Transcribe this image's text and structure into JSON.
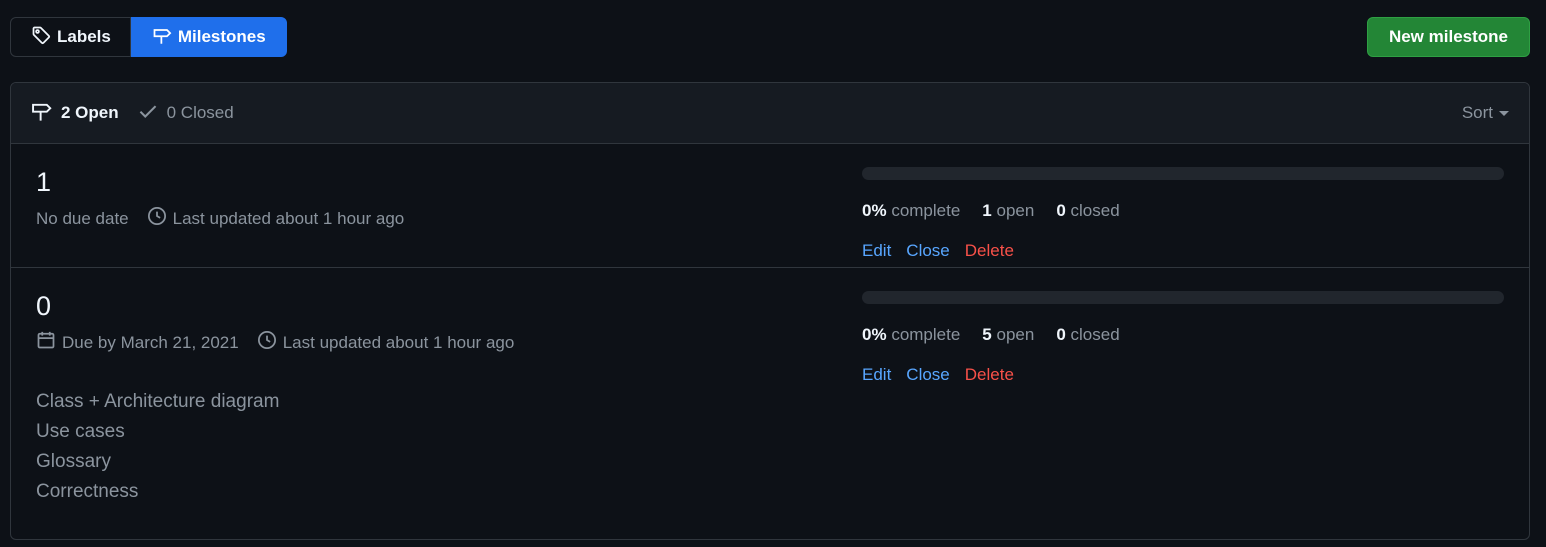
{
  "toolbar": {
    "labels_tab": "Labels",
    "milestones_tab": "Milestones",
    "new_milestone": "New milestone"
  },
  "header": {
    "open_label": "2 Open",
    "closed_label": "0 Closed",
    "sort_label": "Sort"
  },
  "milestones": [
    {
      "title": "1",
      "due": "No due date",
      "updated": "Last updated about 1 hour ago",
      "description": [],
      "progress_percent": 0,
      "complete_value": "0%",
      "complete_label": "complete",
      "open_count": "1",
      "open_label": "open",
      "closed_count": "0",
      "closed_label": "closed",
      "edit": "Edit",
      "close": "Close",
      "delete": "Delete"
    },
    {
      "title": "0",
      "due": "Due by March 21, 2021",
      "updated": "Last updated about 1 hour ago",
      "description": [
        "Class + Architecture diagram",
        "Use cases",
        "Glossary",
        "Correctness"
      ],
      "progress_percent": 0,
      "complete_value": "0%",
      "complete_label": "complete",
      "open_count": "5",
      "open_label": "open",
      "closed_count": "0",
      "closed_label": "closed",
      "edit": "Edit",
      "close": "Close",
      "delete": "Delete"
    }
  ],
  "colors": {
    "background": "#0d1117",
    "accent_blue": "#1f6feb",
    "primary_green": "#238636",
    "link": "#58a6ff",
    "danger": "#f85149"
  }
}
